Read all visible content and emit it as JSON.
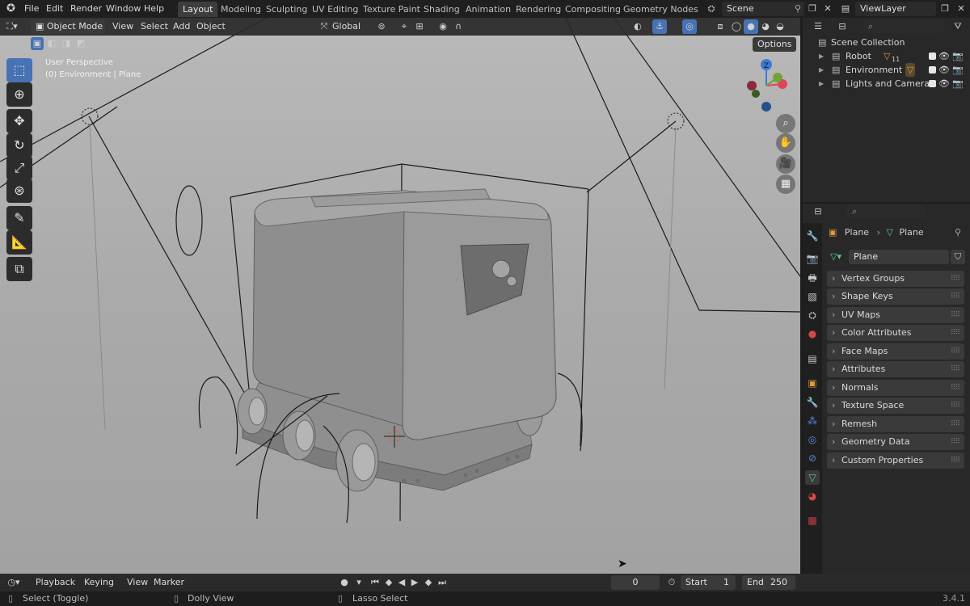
{
  "app_menu": [
    "File",
    "Edit",
    "Render",
    "Window",
    "Help"
  ],
  "workspaces": [
    "Layout",
    "Modeling",
    "Sculpting",
    "UV Editing",
    "Texture Paint",
    "Shading",
    "Animation",
    "Rendering",
    "Compositing",
    "Geometry Nodes"
  ],
  "active_workspace": "Layout",
  "scene_name": "Scene",
  "view_layer": "ViewLayer",
  "viewport_header": {
    "mode": "Object Mode",
    "menus": [
      "View",
      "Select",
      "Add",
      "Object"
    ],
    "transform_orientation": "Global",
    "options_label": "Options"
  },
  "viewport_info": {
    "view_name": "User Perspective",
    "context": "(0) Environment | Plane"
  },
  "outliner": {
    "root": "Scene Collection",
    "items": [
      {
        "label": "Robot",
        "badge": "11"
      },
      {
        "label": "Environment",
        "badge": ""
      },
      {
        "label": "Lights and Cameras",
        "badge": ""
      }
    ]
  },
  "properties": {
    "breadcrumb_object": "Plane",
    "breadcrumb_data": "Plane",
    "data_name": "Plane",
    "panels": [
      "Vertex Groups",
      "Shape Keys",
      "UV Maps",
      "Color Attributes",
      "Face Maps",
      "Attributes",
      "Normals",
      "Texture Space",
      "Remesh",
      "Geometry Data",
      "Custom Properties"
    ]
  },
  "timeline": {
    "menus": [
      "Playback",
      "Keying",
      "View",
      "Marker"
    ],
    "current_frame": "0",
    "start_label": "Start",
    "start_value": "1",
    "end_label": "End",
    "end_value": "250"
  },
  "statusbar": {
    "hint1": "Select (Toggle)",
    "hint2": "Dolly View",
    "hint3": "Lasso Select",
    "version": "3.4.1"
  },
  "colors": {
    "accent": "#4772b3",
    "axis_x": "#e0445c",
    "axis_y": "#6fa33a",
    "axis_z": "#3d7ad6",
    "mesh_icon": "#5fcf8a"
  }
}
